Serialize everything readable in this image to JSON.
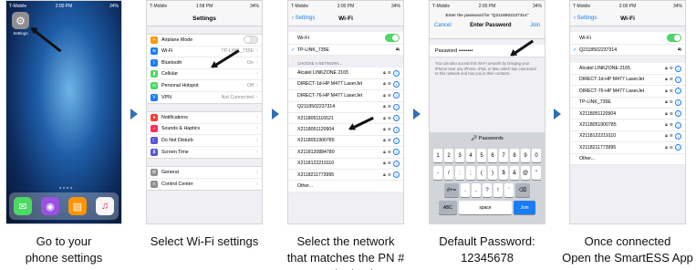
{
  "steps": [
    {
      "caption": "Go to your\nphone settings"
    },
    {
      "caption": "Select Wi-Fi settings"
    },
    {
      "caption": "Select the network\nthat matches the PN #\non the back"
    },
    {
      "caption": "Default Password:\n12345678"
    },
    {
      "caption": "Once connected\nOpen the SmartESS App"
    }
  ],
  "status": {
    "carrier": "T-Mobile",
    "network": "Wi-Fi",
    "time_home": "2:00 PM",
    "time_settings": "1:58 PM",
    "time_wifi": "2:00 PM",
    "battery": "34%"
  },
  "home": {
    "settings_label": "Settings",
    "dock": [
      "Messages",
      "Podcasts",
      "Books",
      "Music"
    ]
  },
  "settings": {
    "title": "Settings",
    "group1": [
      {
        "label": "Airplane Mode",
        "value": "",
        "icon_color": "#ff9500",
        "icon": "airplane-icon"
      },
      {
        "label": "Wi-Fi",
        "value": "TP-LINK_735E",
        "icon_color": "#1a7cf5",
        "icon": "wifi-icon"
      },
      {
        "label": "Bluetooth",
        "value": "On",
        "icon_color": "#1a7cf5",
        "icon": "bluetooth-icon"
      },
      {
        "label": "Cellular",
        "value": "",
        "icon_color": "#4cd964",
        "icon": "cellular-icon"
      },
      {
        "label": "Personal Hotspot",
        "value": "Off",
        "icon_color": "#4cd964",
        "icon": "hotspot-icon"
      },
      {
        "label": "VPN",
        "value": "Not Connected",
        "icon_color": "#1a7cf5",
        "icon": "vpn-icon"
      }
    ],
    "group2": [
      {
        "label": "Notifications",
        "icon_color": "#ff3b30",
        "icon": "notifications-icon"
      },
      {
        "label": "Sounds & Haptics",
        "icon_color": "#ff2d55",
        "icon": "sounds-icon"
      },
      {
        "label": "Do Not Disturb",
        "icon_color": "#5856d6",
        "icon": "moon-icon"
      },
      {
        "label": "Screen Time",
        "icon_color": "#5856d6",
        "icon": "hourglass-icon"
      }
    ],
    "group3": [
      {
        "label": "General",
        "icon_color": "#8e8e93",
        "icon": "gear-icon"
      },
      {
        "label": "Control Center",
        "icon_color": "#8e8e93",
        "icon": "control-center-icon"
      }
    ]
  },
  "wifi_select": {
    "back": "Settings",
    "title": "Wi-Fi",
    "wifi_label": "Wi-Fi",
    "current": "TP-LINK_735E",
    "section": "CHOOSE A NETWORK...",
    "networks": [
      "Alcatel LINKZONE 2165",
      "DIRECT-1d-HP M477 LaserJet",
      "DIRECT-76-HP M477 LaserJet",
      "Q2118502237314",
      "X2118051116521",
      "X2118051120904",
      "X2118051900785",
      "X2118120884780",
      "X2118122219110",
      "X2118211773995",
      "Other..."
    ]
  },
  "password": {
    "prompt": "Enter the password for \"Q2118502237314\"",
    "cancel": "Cancel",
    "title": "Enter Password",
    "join": "Join",
    "field_label": "Password",
    "field_value": "••••••••",
    "note": "You can also access this Wi-Fi network by bringing your iPhone near any iPhone, iPad, or Mac which has connected to this network and has you in their contacts.",
    "keyboard_bar": "Passwords",
    "row1": [
      "1",
      "2",
      "3",
      "4",
      "5",
      "6",
      "7",
      "8",
      "9",
      "0"
    ],
    "row2": [
      "-",
      "/",
      ":",
      ";",
      "(",
      ")",
      "$",
      "&",
      "@",
      "\""
    ],
    "row3": [
      "#+=",
      ".",
      ",",
      "?",
      "!",
      "'",
      "⌫"
    ],
    "abc": "ABC",
    "space": "space",
    "join_key": "Join"
  },
  "wifi_connected": {
    "back": "Settings",
    "title": "Wi-Fi",
    "wifi_label": "Wi-Fi",
    "current": "Q2118502237314",
    "networks": [
      "Alcatel LINKZONE 2165",
      "DIRECT-1d-HP M477 LaserJet",
      "DIRECT-76-HP M477 LaserJet",
      "TP-LINK_735E",
      "X2118051120904",
      "X2118051900785",
      "X2118122219110",
      "X2118211773995",
      "Other..."
    ]
  }
}
